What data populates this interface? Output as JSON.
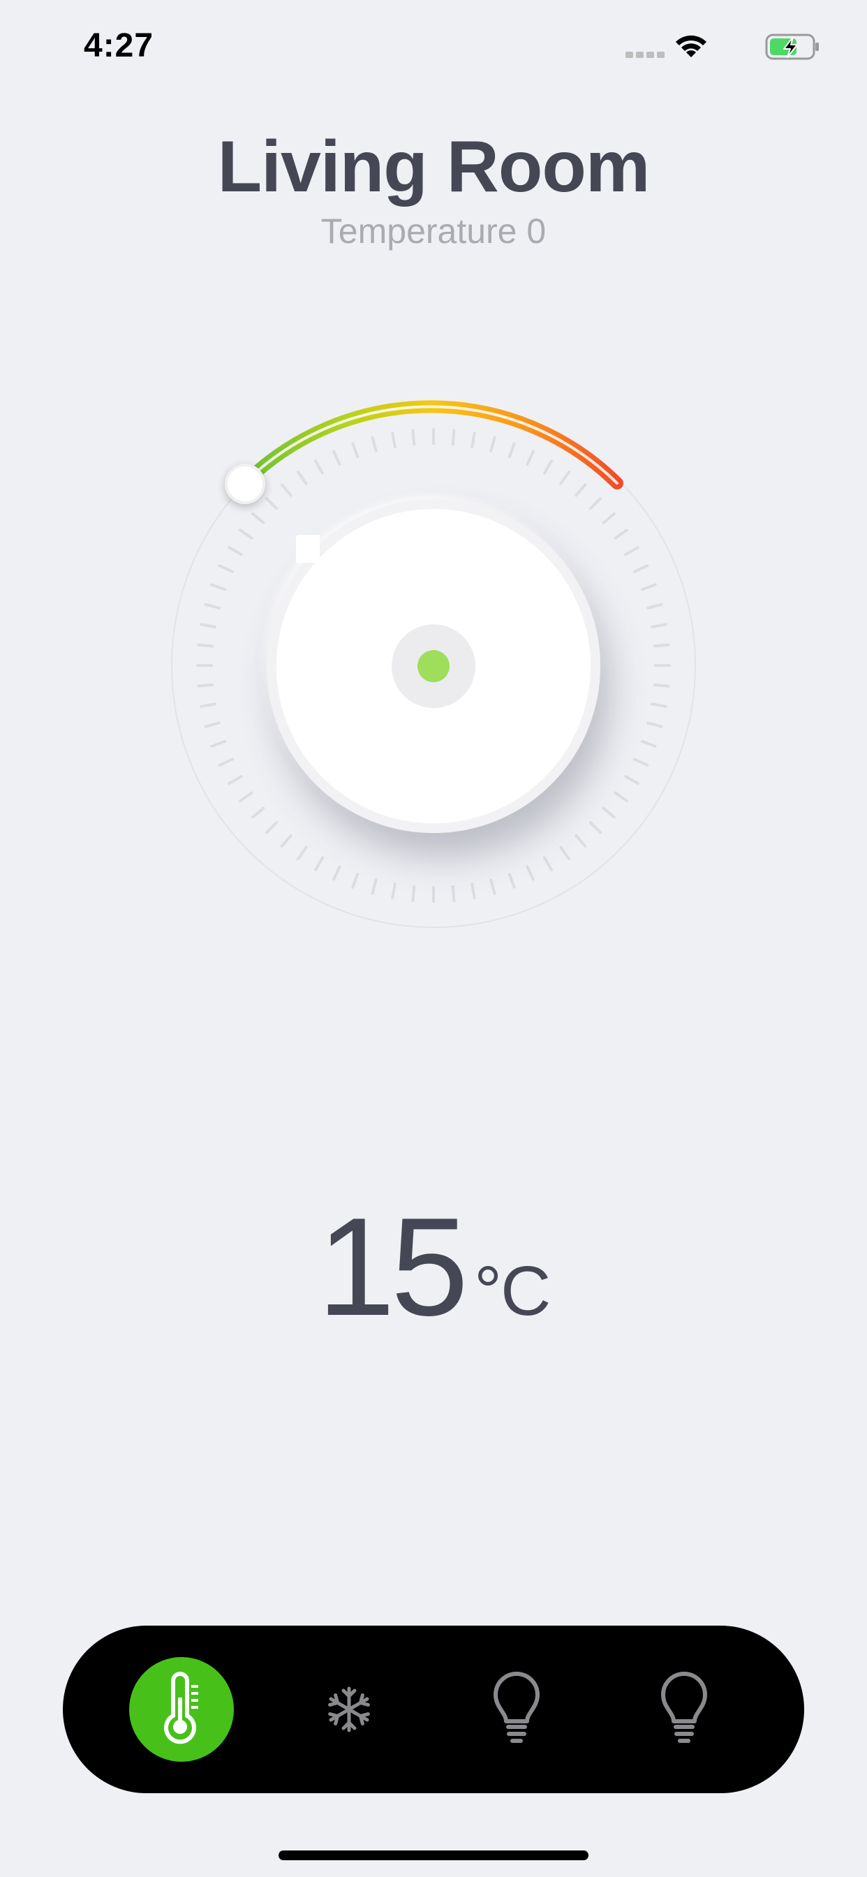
{
  "status_bar": {
    "time": "4:27",
    "icons": [
      "signal-dots-icon",
      "wifi-icon",
      "battery-charging-icon"
    ],
    "battery_color": "#4cd964"
  },
  "header": {
    "title": "Living Room",
    "subtitle": "Temperature 0"
  },
  "dial": {
    "level": 0,
    "arc_colors": [
      "#6cc03a",
      "#b8d21c",
      "#f7c615",
      "#f7941e",
      "#f04a2a"
    ],
    "indicator_color": "#9fde5a"
  },
  "temperature": {
    "value": "15",
    "unit": "°C"
  },
  "tab_bar": {
    "tabs": [
      {
        "icon": "thermometer-icon",
        "active": true
      },
      {
        "icon": "snowflake-icon",
        "active": false
      },
      {
        "icon": "light-bulb-icon",
        "active": false
      },
      {
        "icon": "light-bulb-icon",
        "active": false
      }
    ],
    "active_color": "#47c11a"
  }
}
